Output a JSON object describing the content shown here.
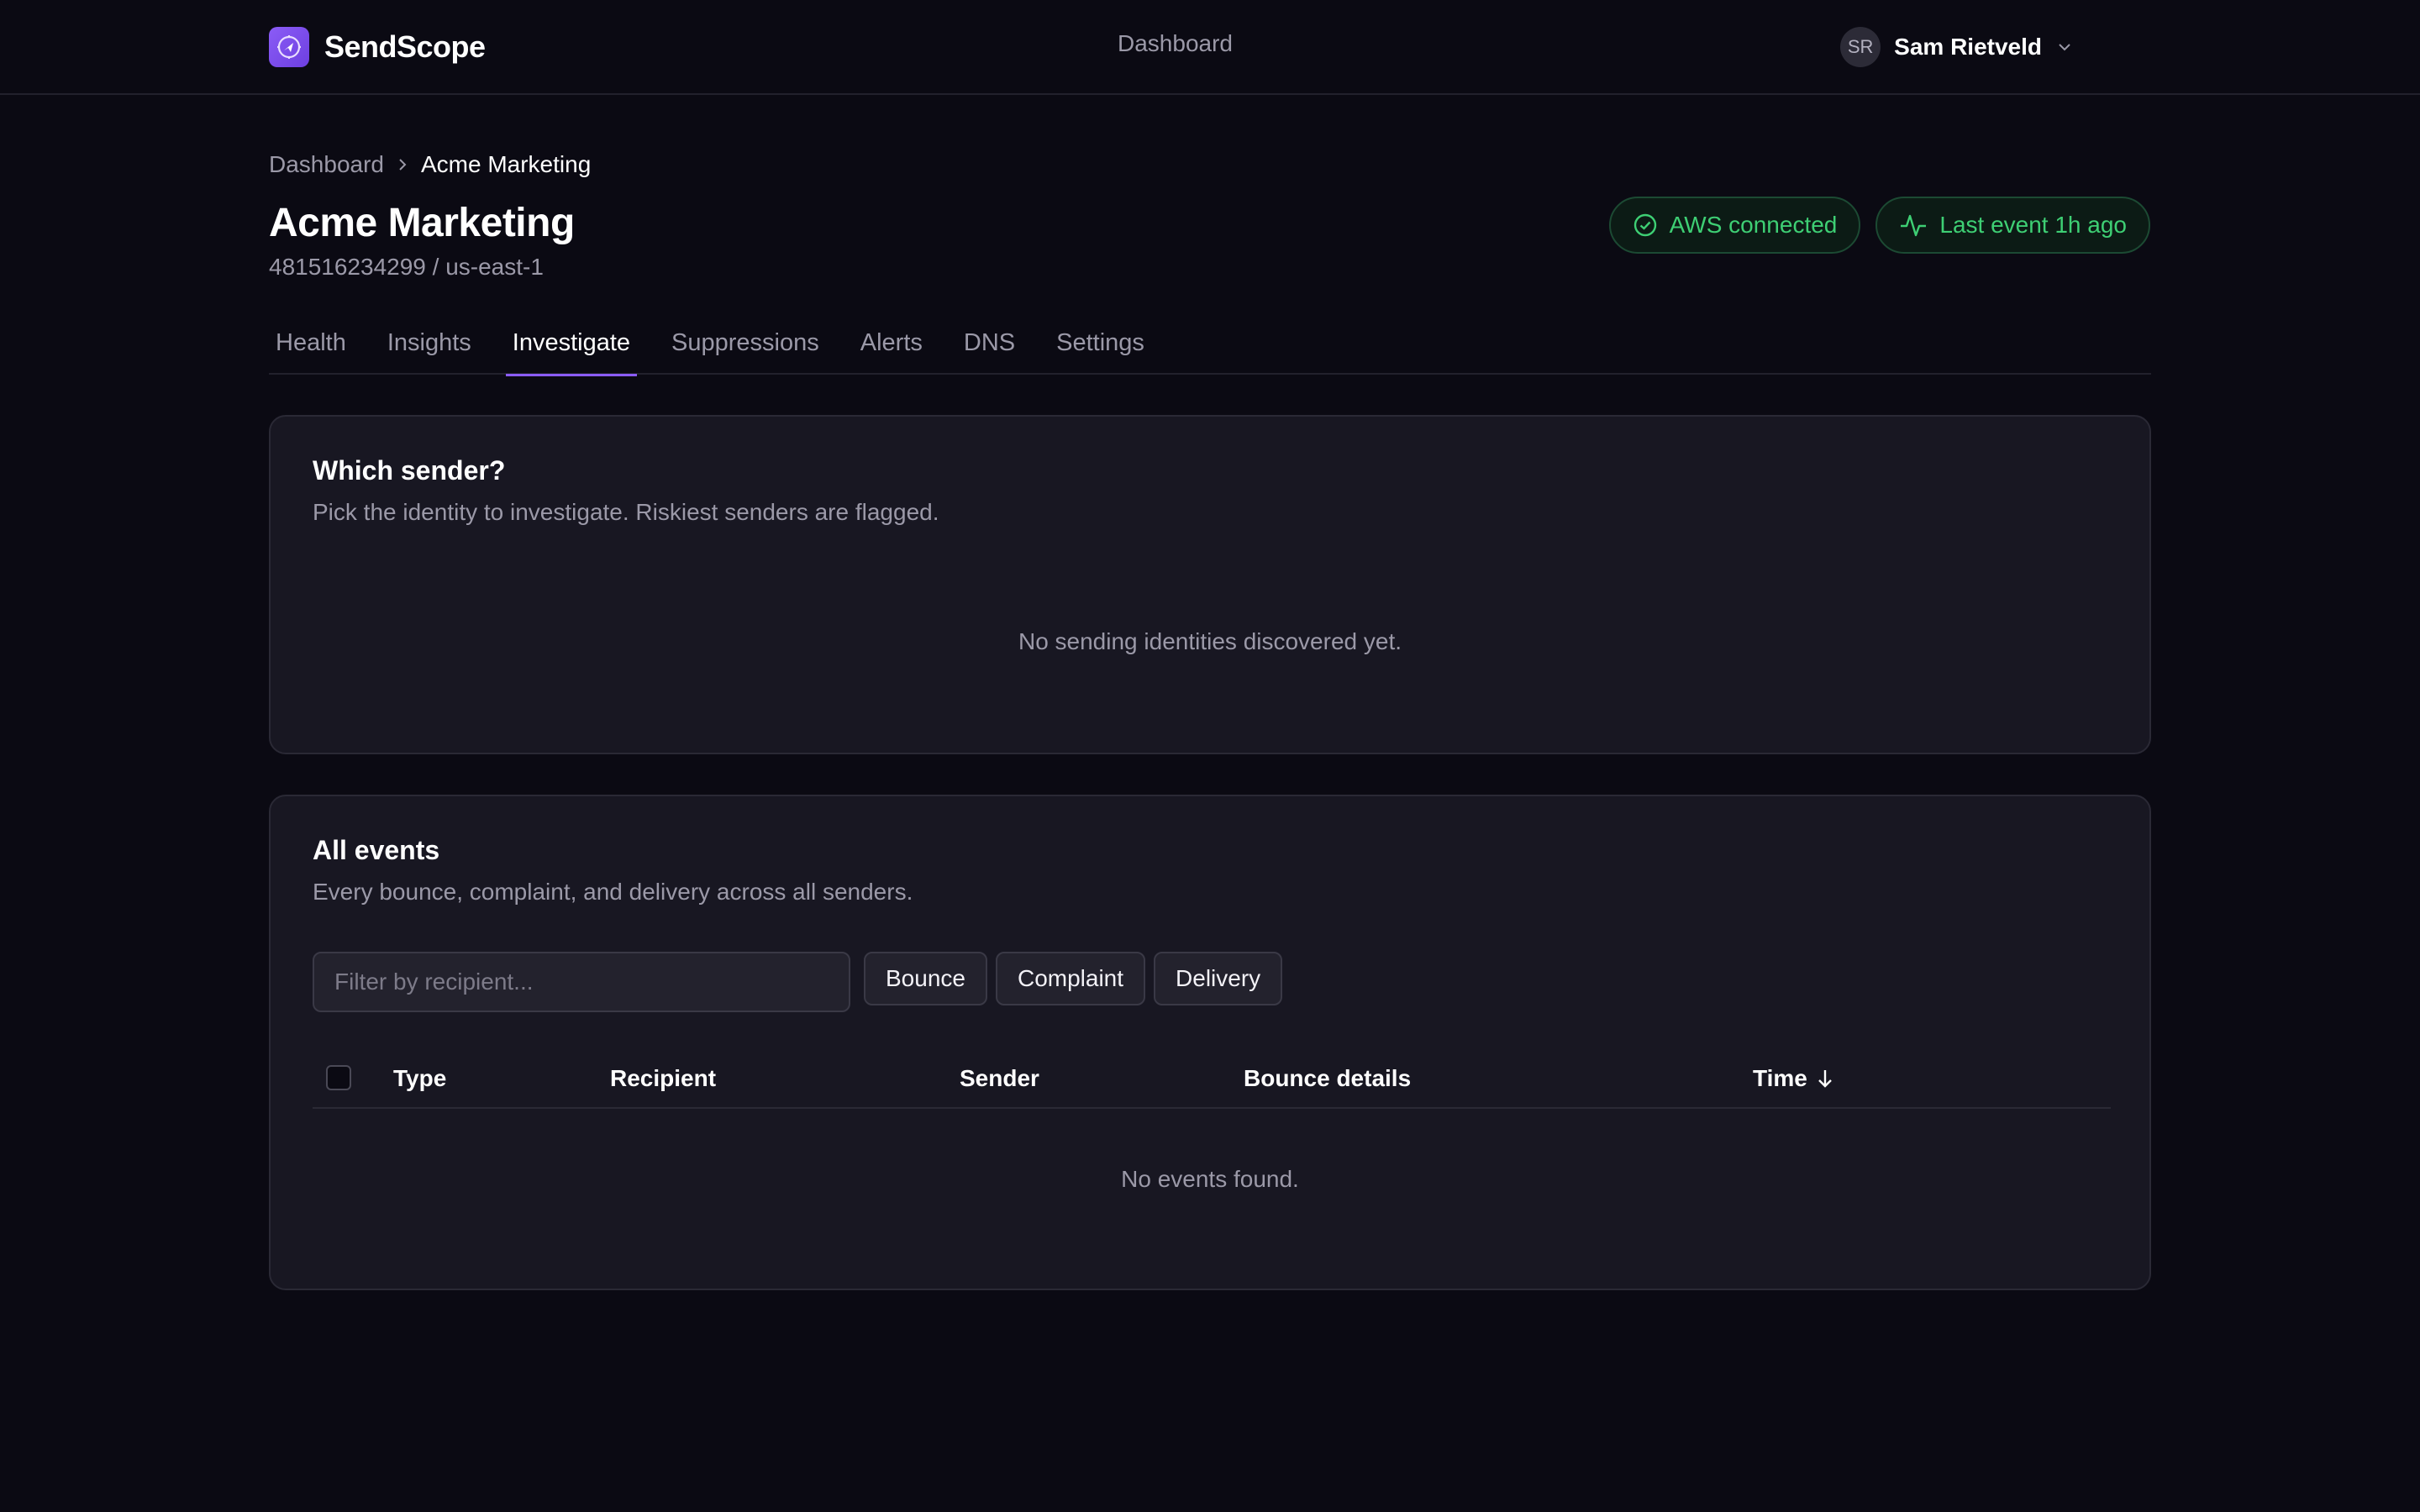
{
  "app": {
    "name": "SendScope"
  },
  "topnav": {
    "dashboard": "Dashboard"
  },
  "user": {
    "initials": "SR",
    "name": "Sam Rietveld"
  },
  "breadcrumb": {
    "root": "Dashboard",
    "current": "Acme Marketing"
  },
  "page": {
    "title": "Acme Marketing",
    "subtitle": "481516234299 / us-east-1"
  },
  "status": {
    "aws": "AWS connected",
    "last_event": "Last event 1h ago",
    "color": "#3ecf74"
  },
  "tabs": [
    {
      "label": "Health"
    },
    {
      "label": "Insights"
    },
    {
      "label": "Investigate",
      "active": true
    },
    {
      "label": "Suppressions"
    },
    {
      "label": "Alerts"
    },
    {
      "label": "DNS"
    },
    {
      "label": "Settings"
    }
  ],
  "sender_card": {
    "title": "Which sender?",
    "subtitle": "Pick the identity to investigate. Riskiest senders are flagged.",
    "empty": "No sending identities discovered yet."
  },
  "events_card": {
    "title": "All events",
    "subtitle": "Every bounce, complaint, and delivery across all senders.",
    "filter_placeholder": "Filter by recipient...",
    "chips": [
      "Bounce",
      "Complaint",
      "Delivery"
    ],
    "columns": {
      "type": "Type",
      "recipient": "Recipient",
      "sender": "Sender",
      "bounce_details": "Bounce details",
      "time": "Time"
    },
    "empty": "No events found."
  },
  "colors": {
    "accent": "#8b5cf6",
    "background": "#0b0a13",
    "card": "#181722"
  }
}
